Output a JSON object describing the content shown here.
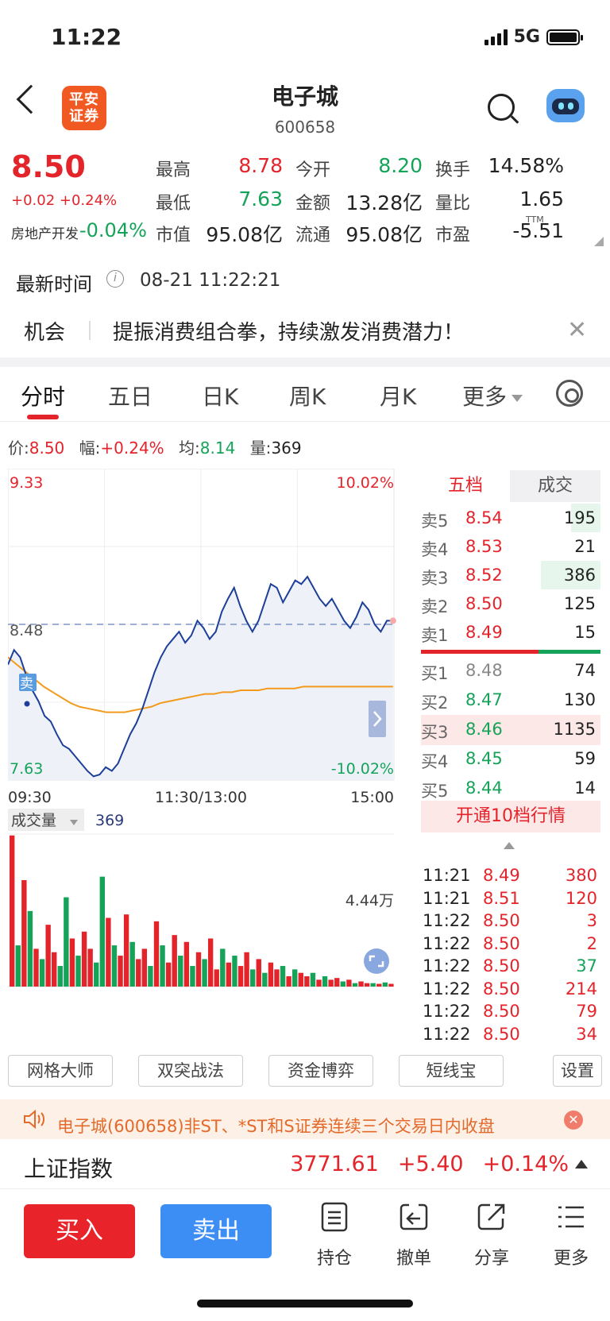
{
  "status": {
    "time": "11:22",
    "network": "5G"
  },
  "header": {
    "logo": "平安证券",
    "title": "电子城",
    "code": "600658"
  },
  "quote": {
    "price": "8.50",
    "change": "+0.02 +0.24%",
    "sector_name": "房地产开发",
    "sector_change": "-0.04%",
    "fields": [
      {
        "label": "最高",
        "value": "8.78",
        "color": "red"
      },
      {
        "label": "今开",
        "value": "8.20",
        "color": "green"
      },
      {
        "label": "换手",
        "value": "14.58%",
        "color": "dark"
      },
      {
        "label": "最低",
        "value": "7.63",
        "color": "green"
      },
      {
        "label": "金额",
        "value": "13.28亿",
        "color": "dark"
      },
      {
        "label": "量比",
        "value": "1.65",
        "color": "dark"
      },
      {
        "label": "市值",
        "value": "95.08亿",
        "color": "dark"
      },
      {
        "label": "流通",
        "value": "95.08亿",
        "color": "dark"
      },
      {
        "label": "市盈",
        "value": "-5.51",
        "color": "dark"
      }
    ],
    "ttm": "TTM"
  },
  "update": {
    "label": "最新时间",
    "info": "i",
    "time": "08-21 11:22:21"
  },
  "news": {
    "tag": "机会",
    "text": "提振消费组合拳，持续激发消费潜力！",
    "close": "✕"
  },
  "tabs": [
    "分时",
    "五日",
    "日K",
    "周K",
    "月K",
    "更多"
  ],
  "info_bar": {
    "price_label": "价:",
    "price": "8.50",
    "amp_label": "幅:",
    "amp": "+0.24%",
    "avg_label": "均:",
    "avg": "8.14",
    "vol_label": "量:",
    "vol": "369"
  },
  "chart_data": {
    "type": "line",
    "ylim": [
      7.63,
      9.33
    ],
    "prev_close": 8.48,
    "pct_top": "10.02%",
    "pct_bottom": "-10.02%",
    "y_labels": [
      "9.33",
      "8.48",
      "7.63"
    ],
    "x_labels": [
      "09:30",
      "11:30/13:00",
      "15:00"
    ],
    "trade_marker": "卖",
    "series": [
      {
        "name": "价",
        "values": [
          8.26,
          8.34,
          8.3,
          8.2,
          8.12,
          8.06,
          7.98,
          7.95,
          7.88,
          7.82,
          7.8,
          7.76,
          7.72,
          7.68,
          7.65,
          7.66,
          7.7,
          7.68,
          7.72,
          7.8,
          7.88,
          7.94,
          8.02,
          8.12,
          8.22,
          8.3,
          8.36,
          8.4,
          8.44,
          8.38,
          8.42,
          8.5,
          8.46,
          8.4,
          8.44,
          8.55,
          8.62,
          8.68,
          8.58,
          8.5,
          8.44,
          8.5,
          8.6,
          8.7,
          8.68,
          8.6,
          8.66,
          8.72,
          8.7,
          8.74,
          8.68,
          8.62,
          8.58,
          8.62,
          8.56,
          8.5,
          8.46,
          8.52,
          8.6,
          8.56,
          8.48,
          8.44,
          8.5,
          8.5
        ]
      },
      {
        "name": "均",
        "values": [
          8.3,
          8.26,
          8.22,
          8.18,
          8.14,
          8.11,
          8.08,
          8.05,
          8.03,
          8.02,
          8.01,
          8.0,
          8.0,
          8.0,
          8.01,
          8.02,
          8.03,
          8.05,
          8.06,
          8.07,
          8.08,
          8.09,
          8.1,
          8.1,
          8.11,
          8.11,
          8.12,
          8.12,
          8.12,
          8.13,
          8.13,
          8.13,
          8.13,
          8.14,
          8.14,
          8.14,
          8.14,
          8.14,
          8.14,
          8.14,
          8.14,
          8.14,
          8.14,
          8.14
        ]
      }
    ],
    "volume": {
      "label": "成交量",
      "current": "369",
      "max_label": "4.44万",
      "values": [
        4.4,
        1.2,
        3.1,
        2.2,
        1.1,
        0.8,
        1.8,
        1.0,
        0.6,
        2.6,
        1.4,
        0.9,
        1.6,
        1.1,
        0.7,
        3.2,
        2.0,
        1.2,
        0.9,
        2.1,
        1.3,
        0.8,
        1.1,
        0.6,
        1.9,
        1.2,
        0.7,
        1.5,
        0.9,
        1.3,
        0.6,
        1.0,
        0.8,
        1.4,
        0.5,
        1.1,
        0.7,
        0.9,
        0.6,
        1.0,
        0.5,
        0.8,
        0.4,
        0.7,
        0.5,
        0.6,
        0.3,
        0.5,
        0.4,
        0.3,
        0.4,
        0.2,
        0.3,
        0.2,
        0.25,
        0.15,
        0.2,
        0.1,
        0.15,
        0.1,
        0.1,
        0.08,
        0.12,
        0.08
      ],
      "colors": [
        "r",
        "g",
        "r",
        "g",
        "r",
        "g",
        "r",
        "r",
        "g",
        "g",
        "r",
        "g",
        "r",
        "r",
        "g",
        "g",
        "r",
        "g",
        "r",
        "r",
        "g",
        "r",
        "r",
        "g",
        "r",
        "g",
        "r",
        "r",
        "g",
        "r",
        "g",
        "r",
        "g",
        "r",
        "r",
        "g",
        "r",
        "g",
        "r",
        "r",
        "g",
        "r",
        "g",
        "r",
        "r",
        "g",
        "r",
        "g",
        "r",
        "r",
        "g",
        "r",
        "g",
        "r",
        "r",
        "g",
        "r",
        "g",
        "r",
        "r",
        "g",
        "r",
        "g",
        "r"
      ]
    }
  },
  "orderbook": {
    "tab_active": "五档",
    "tab_other": "成交",
    "sells": [
      {
        "label": "卖5",
        "price": "8.54",
        "vol": "195",
        "bar": 0.22
      },
      {
        "label": "卖4",
        "price": "8.53",
        "vol": "21",
        "bar": 0
      },
      {
        "label": "卖3",
        "price": "8.52",
        "vol": "386",
        "bar": 0.44
      },
      {
        "label": "卖2",
        "price": "8.50",
        "vol": "125",
        "bar": 0
      },
      {
        "label": "卖1",
        "price": "8.49",
        "vol": "15",
        "bar": 0
      }
    ],
    "buys": [
      {
        "label": "买1",
        "price": "8.48",
        "vol": "74",
        "hl": false
      },
      {
        "label": "买2",
        "price": "8.47",
        "vol": "130",
        "hl": false
      },
      {
        "label": "买3",
        "price": "8.46",
        "vol": "1135",
        "hl": true
      },
      {
        "label": "买4",
        "price": "8.45",
        "vol": "59",
        "hl": false
      },
      {
        "label": "买5",
        "price": "8.44",
        "vol": "14",
        "hl": false
      }
    ],
    "open10": "开通10档行情",
    "ticks": [
      {
        "time": "11:21",
        "price": "8.49",
        "vol": "380",
        "dir": "red"
      },
      {
        "time": "11:21",
        "price": "8.51",
        "vol": "120",
        "dir": "red"
      },
      {
        "time": "11:22",
        "price": "8.50",
        "vol": "3",
        "dir": "red"
      },
      {
        "time": "11:22",
        "price": "8.50",
        "vol": "2",
        "dir": "red"
      },
      {
        "time": "11:22",
        "price": "8.50",
        "vol": "37",
        "dir": "green"
      },
      {
        "time": "11:22",
        "price": "8.50",
        "vol": "214",
        "dir": "red"
      },
      {
        "time": "11:22",
        "price": "8.50",
        "vol": "79",
        "dir": "red"
      },
      {
        "time": "11:22",
        "price": "8.50",
        "vol": "34",
        "dir": "red"
      }
    ]
  },
  "tools": [
    "网格大师",
    "双突战法",
    "资金博弈",
    "短线宝",
    "设置"
  ],
  "notice": {
    "text": "电子城(600658)非ST、*ST和S证券连续三个交易日内收盘",
    "close": "✕"
  },
  "index": {
    "name": "上证指数",
    "value": "3771.61",
    "change": "+5.40",
    "pct": "+0.14%"
  },
  "bottom": {
    "buy": "买入",
    "sell": "卖出",
    "actions": [
      "持仓",
      "撤单",
      "分享",
      "更多"
    ]
  },
  "colors": {
    "red": "#e3242b",
    "green": "#15a35a",
    "orange": "#f39a1d",
    "blue": "#1d3f9a"
  }
}
